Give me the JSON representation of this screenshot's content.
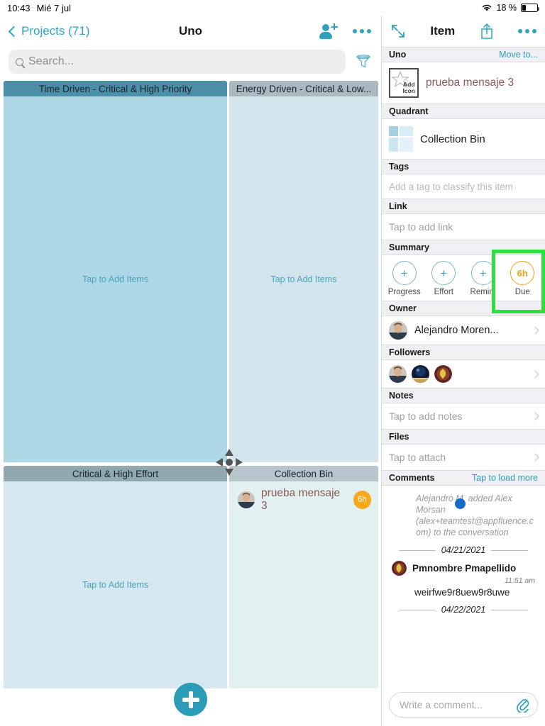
{
  "statusbar": {
    "time": "10:43",
    "date": "Mié 7 jul",
    "battery_pct": "18 %",
    "wifi_icon": "wifi-icon",
    "battery_icon": "battery-icon"
  },
  "left_panel": {
    "nav": {
      "back_label": "Projects (71)",
      "title": "Uno",
      "add_user_icon": "add-user-icon",
      "more_icon": "more-options-icon"
    },
    "search": {
      "placeholder": "Search...",
      "search_icon": "search-icon",
      "filter_icon": "filter-funnel-icon"
    },
    "quadrants": [
      {
        "key": "top_left",
        "title": "Time Driven - Critical & High Priority",
        "empty_label": "Tap to Add Items",
        "header_color": "#4b90a8",
        "body_color": "#aed8e6"
      },
      {
        "key": "top_right",
        "title": "Energy Driven - Critical & Low...",
        "empty_label": "Tap to Add Items",
        "header_color": "#a9b9bf",
        "body_color": "#d2e5ec"
      },
      {
        "key": "bottom_left",
        "title": "Critical & High Effort",
        "empty_label": "Tap to Add Items",
        "header_color": "#8fa8b2",
        "body_color": "#d6e8ef"
      },
      {
        "key": "bottom_right",
        "title": "Collection Bin",
        "empty_label": "",
        "header_color": "#b7c6ca",
        "body_color": "#e3f0f2"
      }
    ],
    "bin_item": {
      "title": "prueba mensaje 3",
      "badge": "6h",
      "avatar_name": "avatar"
    },
    "drag_handle_icon": "move-drag-handle-icon",
    "fab": {
      "icon": "plus-icon",
      "color": "#2b9cb8"
    }
  },
  "right_panel": {
    "nav": {
      "expand_icon": "expand-arrows-icon",
      "title": "Item",
      "share_icon": "share-icon",
      "more_icon": "more-options-icon"
    },
    "project_bar": {
      "label": "Uno",
      "action": "Move to..."
    },
    "item": {
      "add_icon_label_line1": "Add",
      "add_icon_label_line2": "Icon",
      "star_icon": "star-icon",
      "title": "prueba mensaje 3"
    },
    "quadrant_section": {
      "title": "Quadrant",
      "value": "Collection Bin",
      "icon": "quadrant-grid-icon"
    },
    "tags_section": {
      "title": "Tags",
      "placeholder": "Add a tag to classify this item"
    },
    "link_section": {
      "title": "Link",
      "placeholder": "Tap to add link"
    },
    "summary_section": {
      "title": "Summary",
      "cells": [
        {
          "value": "+",
          "label": "Progress",
          "highlighted": false
        },
        {
          "value": "+",
          "label": "Effort",
          "highlighted": false
        },
        {
          "value": "+",
          "label": "Remin.",
          "highlighted": false
        },
        {
          "value": "6h",
          "label": "Due",
          "highlighted": true
        }
      ],
      "highlight_color": "#2ee03f"
    },
    "owner_section": {
      "title": "Owner",
      "name": "Alejandro Moren...",
      "avatar": "avatar"
    },
    "followers_section": {
      "title": "Followers",
      "avatars": [
        "avatar-1",
        "avatar-2",
        "avatar-3"
      ]
    },
    "notes_section": {
      "title": "Notes",
      "placeholder": "Tap to add notes"
    },
    "files_section": {
      "title": "Files",
      "placeholder": "Tap to attach"
    },
    "comments_section": {
      "title": "Comments",
      "action": "Tap to load more",
      "system_message": "Alejandro M. added Alex Morsan (alex+teamtest@appfluence.com) to the conversation",
      "date_divider_1": "04/21/2021",
      "comment": {
        "author": "Pmnombre Pmapellido",
        "time": "11:51 am",
        "body": "weirfwe9r8uew9r8uwe"
      },
      "date_divider_2": "04/22/2021"
    },
    "comment_input": {
      "placeholder": "Write a comment...",
      "attach_icon": "paperclip-icon"
    }
  },
  "cursor": {
    "type": "touch-indicator",
    "color": "#1569c7"
  }
}
